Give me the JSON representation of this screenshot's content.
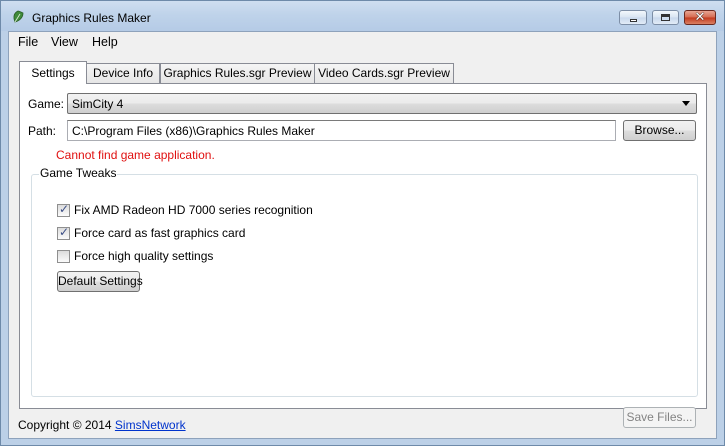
{
  "window": {
    "title": "Graphics Rules Maker",
    "icon": "green-leaf-app-icon"
  },
  "menu": {
    "items": [
      {
        "label": "File"
      },
      {
        "label": "View"
      },
      {
        "label": "Help"
      }
    ]
  },
  "tabs": [
    {
      "label": "Settings",
      "active": true
    },
    {
      "label": "Device Info",
      "active": false
    },
    {
      "label": "Graphics Rules.sgr Preview",
      "active": false
    },
    {
      "label": "Video Cards.sgr Preview",
      "active": false
    }
  ],
  "settings": {
    "game_label": "Game:",
    "game_value": "SimCity 4",
    "path_label": "Path:",
    "path_value": "C:\\Program Files (x86)\\Graphics Rules Maker",
    "browse_label": "Browse...",
    "error_text": "Cannot find game application.",
    "error_color": "#e01010",
    "tweaks": {
      "title": "Game Tweaks",
      "options": [
        {
          "label": "Fix AMD Radeon HD 7000 series recognition",
          "checked": true
        },
        {
          "label": "Force card as fast graphics card",
          "checked": true
        },
        {
          "label": "Force high quality settings",
          "checked": false
        }
      ],
      "default_button_label": "Default Settings"
    },
    "save_files_label": "Save Files..."
  },
  "status": {
    "copyright_text": "Copyright © 2014",
    "link_text": "SimsNetwork",
    "link_color": "#0033cc"
  }
}
